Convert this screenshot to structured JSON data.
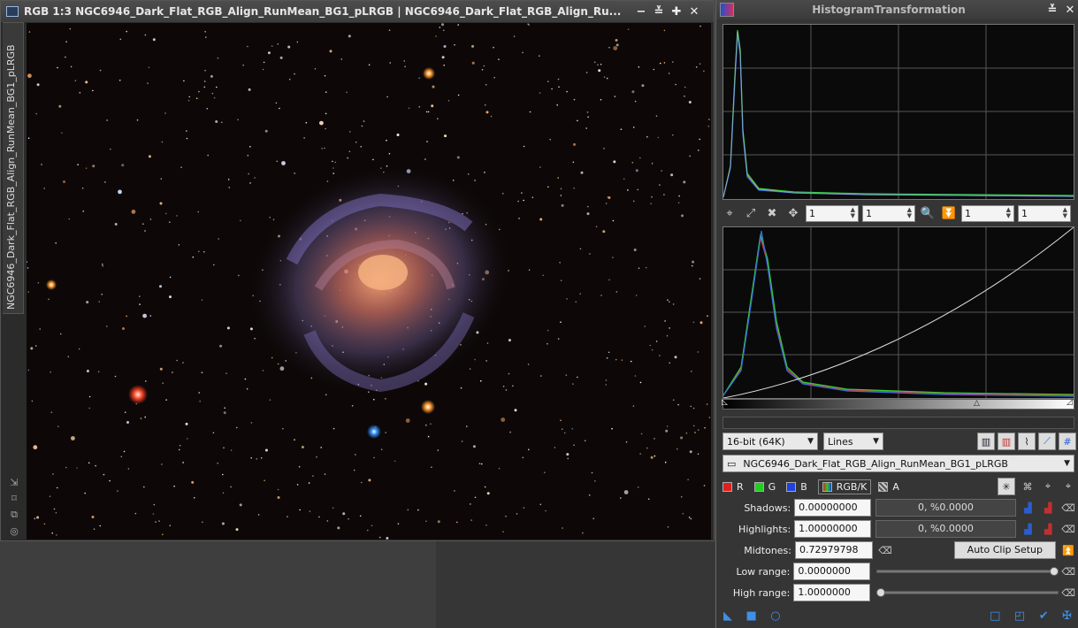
{
  "image_window": {
    "title": "RGB 1:3 NGC6946_Dark_Flat_RGB_Align_RunMean_BG1_pLRGB | NGC6946_Dark_Flat_RGB_Align_Ru...",
    "side_tab_label": "NGC6946_Dark_Flat_RGB_Align_RunMean_BG1_pLRGB",
    "buttons": {
      "minimize": "−",
      "shade": "≚",
      "maximize": "✚",
      "close": "✕"
    }
  },
  "histogram_panel": {
    "title": "HistogramTransformation",
    "zoom_fields": [
      "1",
      "1",
      "1",
      "1"
    ],
    "resolution": "16-bit (64K)",
    "plot_mode": "Lines",
    "view_selector": "NGC6946_Dark_Flat_RGB_Align_RunMean_BG1_pLRGB",
    "channels": [
      {
        "label": "R",
        "color": "#e02020"
      },
      {
        "label": "G",
        "color": "#20d020"
      },
      {
        "label": "B",
        "color": "#2040e0"
      },
      {
        "label": "RGB/K",
        "color": "#888888"
      },
      {
        "label": "A",
        "color": "#cccccc"
      }
    ],
    "shadows_label": "Shadows:",
    "shadows_value": "0.00000000",
    "shadows_clip": "0, %0.0000",
    "highlights_label": "Highlights:",
    "highlights_value": "1.00000000",
    "highlights_clip": "0, %0.0000",
    "midtones_label": "Midtones:",
    "midtones_value": "0.72979798",
    "auto_clip_label": "Auto Clip Setup",
    "low_range_label": "Low range:",
    "low_range_value": "0.0000000",
    "high_range_label": "High range:",
    "high_range_value": "1.0000000",
    "low_range_level": 1.0,
    "high_range_level": 0.0
  },
  "icons": {
    "collapse": "≚",
    "close": "✕"
  }
}
